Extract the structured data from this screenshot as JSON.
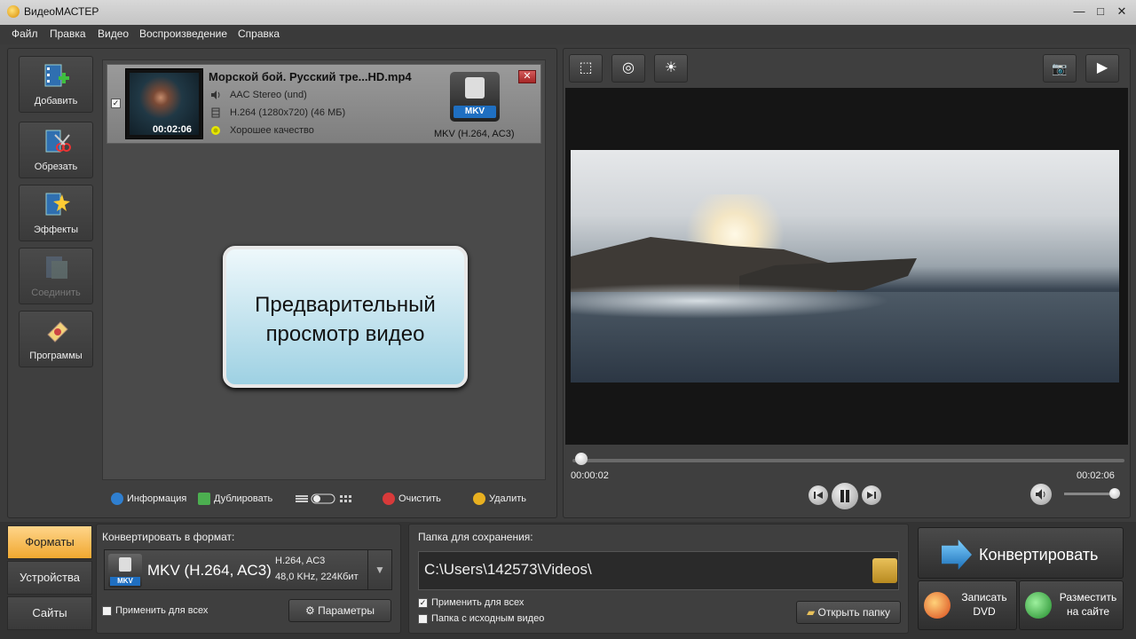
{
  "window": {
    "title": "ВидеоМАСТЕР",
    "min_label": "—",
    "max_label": "□",
    "close_label": "✕"
  },
  "menu": [
    "Файл",
    "Правка",
    "Видео",
    "Воспроизведение",
    "Справка"
  ],
  "toolbar": {
    "add": "Добавить",
    "trim": "Обрезать",
    "effects": "Эффекты",
    "join": "Соединить",
    "programs": "Программы"
  },
  "file": {
    "name": "Морской бой. Русский тре...HD.mp4",
    "audio": "AAC Stereo (und)",
    "video": "H.264 (1280x720) (46 МБ)",
    "quality": "Хорошее качество",
    "duration": "00:02:06",
    "output_badge": "MKV",
    "output_format": "MKV (H.264, AC3)",
    "close_label": "✕",
    "check_label": "✓"
  },
  "callout": {
    "line1": "Предварительный",
    "line2": "просмотр видео"
  },
  "list_toolbar": {
    "info": "Информация",
    "duplicate": "Дублировать",
    "clear": "Очистить",
    "delete": "Удалить"
  },
  "player": {
    "current_time": "00:00:02",
    "total_time": "00:02:06",
    "progress_fraction": 0.016,
    "volume_fraction": 0.95,
    "buttons": {
      "crop": "⬚",
      "record": "◎",
      "brightness": "☀",
      "snapshot": "📷",
      "fullscreen": "▶"
    }
  },
  "tabs": {
    "formats": "Форматы",
    "devices": "Устройства",
    "sites": "Сайты"
  },
  "convert_section": {
    "title": "Конвертировать в формат:",
    "format_name": "MKV (H.264, AC3)",
    "format_badge": "MKV",
    "spec_line1": "H.264, AC3",
    "spec_line2": "48,0 KHz, 224Кбит",
    "apply_all": "Применить для всех",
    "params": "Параметры"
  },
  "save_section": {
    "title": "Папка для сохранения:",
    "path": "C:\\Users\\142573\\Videos\\",
    "apply_all": "Применить для всех",
    "source_folder": "Папка с исходным видео",
    "open_folder": "Открыть папку"
  },
  "actions": {
    "convert": "Конвертировать",
    "burn_dvd_1": "Записать",
    "burn_dvd_2": "DVD",
    "publish_1": "Разместить",
    "publish_2": "на сайте"
  },
  "colors": {
    "accent_tab": "#f0a830",
    "mkv_badge": "#1f6fc1",
    "background": "#3c3c3c"
  }
}
